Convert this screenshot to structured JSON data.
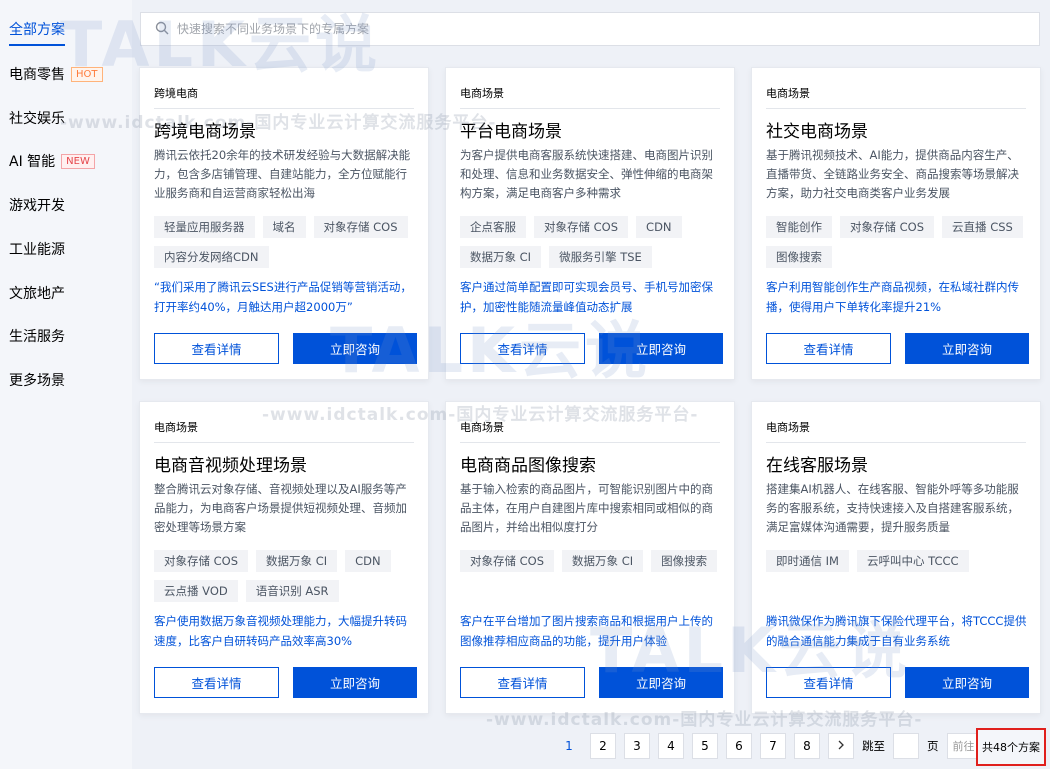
{
  "sidebar": {
    "items": [
      {
        "label": "全部方案"
      },
      {
        "label": "电商零售",
        "badge": "HOT"
      },
      {
        "label": "社交娱乐"
      },
      {
        "label": "AI 智能",
        "badge": "NEW"
      },
      {
        "label": "游戏开发"
      },
      {
        "label": "工业能源"
      },
      {
        "label": "文旅地产"
      },
      {
        "label": "生活服务"
      },
      {
        "label": "更多场景"
      }
    ]
  },
  "search": {
    "placeholder": "快速搜索不同业务场景下的专属方案"
  },
  "cards": [
    {
      "category": "跨境电商",
      "title": "跨境电商场景",
      "description": "腾讯云依托20余年的技术研发经验与大数据解决能力，包含多店铺管理、自建站能力，全方位赋能行业服务商和自运营商家轻松出海",
      "tags": [
        "轻量应用服务器",
        "域名",
        "对象存储 COS",
        "内容分发网络CDN"
      ],
      "quote": "“我们采用了腾讯云SES进行产品促销等营销活动，打开率约40%，月触达用户超2000万”",
      "detail_label": "查看详情",
      "consult_label": "立即咨询"
    },
    {
      "category": "电商场景",
      "title": "平台电商场景",
      "description": "为客户提供电商客服系统快速搭建、电商图片识别和处理、信息和业务数据安全、弹性伸缩的电商架构方案，满足电商客户多种需求",
      "tags": [
        "企点客服",
        "对象存储 COS",
        "CDN",
        "数据万象 CI",
        "微服务引擎 TSE"
      ],
      "quote": "客户通过简单配置即可实现会员号、手机号加密保护，加密性能随流量峰值动态扩展",
      "detail_label": "查看详情",
      "consult_label": "立即咨询"
    },
    {
      "category": "电商场景",
      "title": "社交电商场景",
      "description": "基于腾讯视频技术、AI能力，提供商品内容生产、直播带货、全链路业务安全、商品搜索等场景解决方案，助力社交电商类客户业务发展",
      "tags": [
        "智能创作",
        "对象存储 COS",
        "云直播 CSS",
        "图像搜索"
      ],
      "quote": "客户利用智能创作生产商品视频，在私域社群内传播，使得用户下单转化率提升21%",
      "detail_label": "查看详情",
      "consult_label": "立即咨询"
    },
    {
      "category": "电商场景",
      "title": "电商音视频处理场景",
      "description": "整合腾讯云对象存储、音视频处理以及AI服务等产品能力，为电商客户场景提供短视频处理、音频加密处理等场景方案",
      "tags": [
        "对象存储 COS",
        "数据万象 CI",
        "CDN",
        "云点播 VOD",
        "语音识别 ASR"
      ],
      "quote": "客户使用数据万象音视频处理能力，大幅提升转码速度，比客户自研转码产品效率高30%",
      "detail_label": "查看详情",
      "consult_label": "立即咨询"
    },
    {
      "category": "电商场景",
      "title": "电商商品图像搜索",
      "description": "基于输入检索的商品图片，可智能识别图片中的商品主体，在用户自建图片库中搜索相同或相似的商品图片，并给出相似度打分",
      "tags": [
        "对象存储 COS",
        "数据万象 CI",
        "图像搜索"
      ],
      "quote": "客户在平台增加了图片搜索商品和根据用户上传的图像推荐相应商品的功能，提升用户体验",
      "detail_label": "查看详情",
      "consult_label": "立即咨询"
    },
    {
      "category": "电商场景",
      "title": "在线客服场景",
      "description": "搭建集AI机器人、在线客服、智能外呼等多功能服务的客服系统，支持快速接入及自搭建客服系统，满足富媒体沟通需要，提升服务质量",
      "tags": [
        "即时通信 IM",
        "云呼叫中心 TCCC"
      ],
      "quote": "腾讯微保作为腾讯旗下保险代理平台，将TCCC提供的融合通信能力集成于自有业务系统",
      "detail_label": "查看详情",
      "consult_label": "立即咨询"
    }
  ],
  "pagination": {
    "pages": [
      "1",
      "2",
      "3",
      "4",
      "5",
      "6",
      "7",
      "8"
    ],
    "current": "1",
    "next_icon": "chevron-right-icon",
    "jump_label": "跳至",
    "page_label": "页",
    "go_label": "前往",
    "total_label": "共48个方案"
  },
  "watermark": {
    "brand": "TALK云说",
    "site_text": "-www.idctalk.com-国内专业云计算交流服务平台-"
  },
  "colors": {
    "accent": "#0052d9",
    "highlight_border": "#e0201d",
    "hot": "#ff7b3a",
    "new": "#e5464b"
  }
}
